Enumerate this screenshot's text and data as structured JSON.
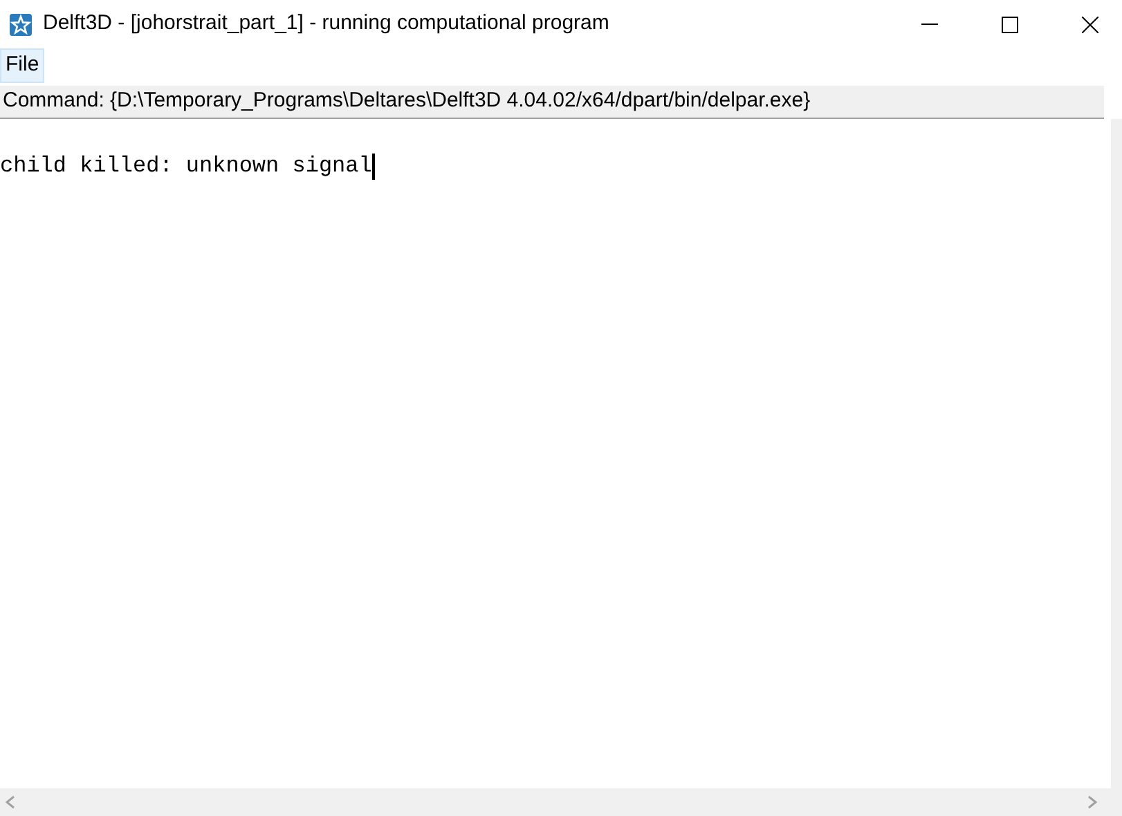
{
  "window": {
    "title": "Delft3D - [johorstrait_part_1] - running computational program"
  },
  "menu": [
    {
      "label": "File",
      "selected": true
    }
  ],
  "command": "Command: {D:\\Temporary_Programs\\Deltares\\Delft3D 4.04.02/x64/dpart/bin/delpar.exe}",
  "output_lines": [
    "child killed: unknown signal"
  ]
}
